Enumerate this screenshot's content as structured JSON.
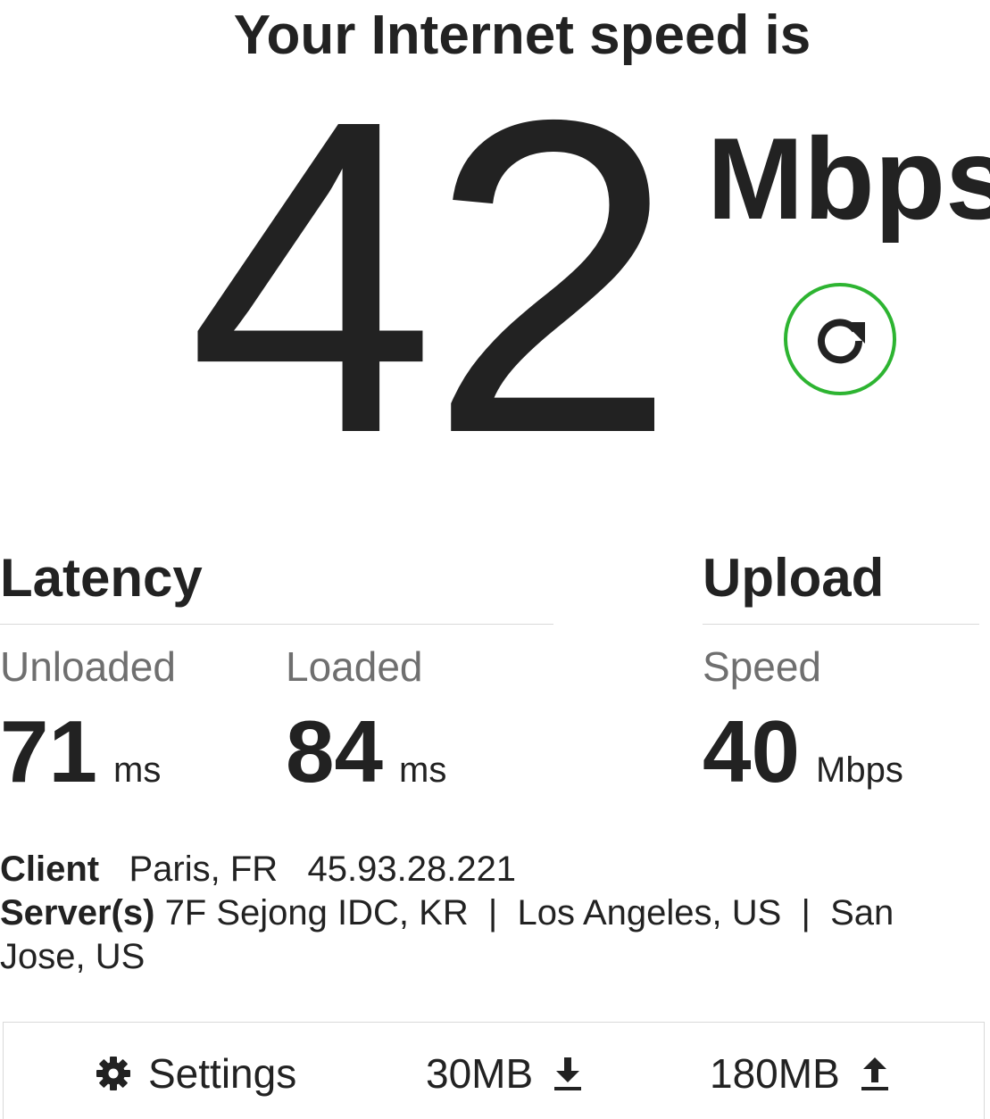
{
  "header": {
    "title": "Your Internet speed is"
  },
  "download": {
    "value": "42",
    "unit": "Mbps"
  },
  "refresh": {
    "icon": "refresh-icon",
    "accent_color": "#2db431"
  },
  "latency": {
    "title": "Latency",
    "unloaded_label": "Unloaded",
    "unloaded_value": "71",
    "unloaded_unit": "ms",
    "loaded_label": "Loaded",
    "loaded_value": "84",
    "loaded_unit": "ms"
  },
  "upload": {
    "title": "Upload",
    "speed_label": "Speed",
    "speed_value": "40",
    "speed_unit": "Mbps"
  },
  "info": {
    "client_label": "Client",
    "client_location": "Paris, FR",
    "client_ip": "45.93.28.221",
    "servers_label": "Server(s)",
    "servers": "7F Sejong IDC, KR  |  Los Angeles, US  |  San Jose, US"
  },
  "footer": {
    "settings_label": "Settings",
    "settings_icon": "gear-icon",
    "download_size": "30MB",
    "download_icon": "download-icon",
    "upload_size": "180MB",
    "upload_icon": "upload-icon"
  }
}
